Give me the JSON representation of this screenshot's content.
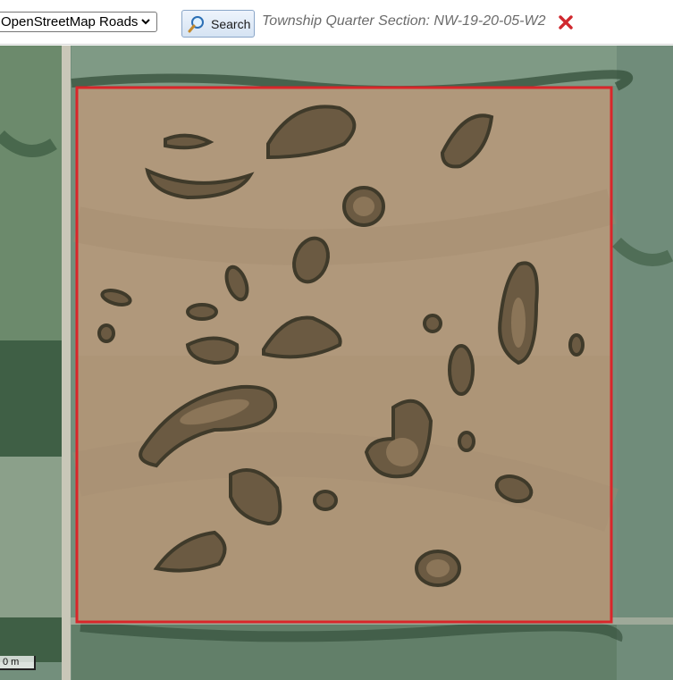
{
  "toolbar": {
    "layer_select_value": "OpenStreetMap Roads",
    "search_label": "Search",
    "section_label": "Township Quarter Section: NW-19-20-05-W2"
  },
  "map": {
    "scale_label": "0 m",
    "boundary_color": "#d9262a",
    "icons": {
      "search": "magnifier-icon",
      "close": "close-icon",
      "dropdown": "chevron-down-icon"
    }
  }
}
